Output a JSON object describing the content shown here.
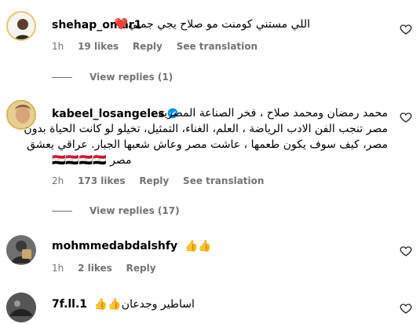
{
  "comments": [
    {
      "username": "shehap_omar1",
      "text": "اللي مستني كومنت مو صلاح يجي جمبي❤️",
      "time": "1h",
      "likes": "19 likes",
      "reply": "Reply",
      "translate": "See translation",
      "view_replies": "View replies (1)"
    },
    {
      "username": "kabeel_losangeles",
      "lines": [
        "محمد رمضان ومحمد صلاح ، فخر الصناعة المصرية ،",
        "مصر تنجب الفن الادب الرياضة ، العلم، الغناء، التمثيل، تخيلو لو كانت الحياة بدون",
        "مصر، كيف سوف يكون طعمها ، عاشت مصر وعاش شعبها الجبار. عراقي يعشق",
        "مصر 🇪🇬🇪🇬🇪🇬🇪🇬"
      ],
      "time": "2h",
      "likes": "173 likes",
      "reply": "Reply",
      "translate": "See translation",
      "view_replies": "View replies (17)"
    },
    {
      "username": "mohmmedabdalshfy",
      "text": "👍👍",
      "time": "1h",
      "likes": "2 likes",
      "reply": "Reply"
    },
    {
      "username": "7f.ll.1",
      "text": "اساطير وجدعان👍👍"
    }
  ],
  "icons": {
    "like": "heart-outline-icon",
    "verified": "verified-badge-icon"
  },
  "colors": {
    "meta": "#737373",
    "verified": "#0095f6"
  }
}
